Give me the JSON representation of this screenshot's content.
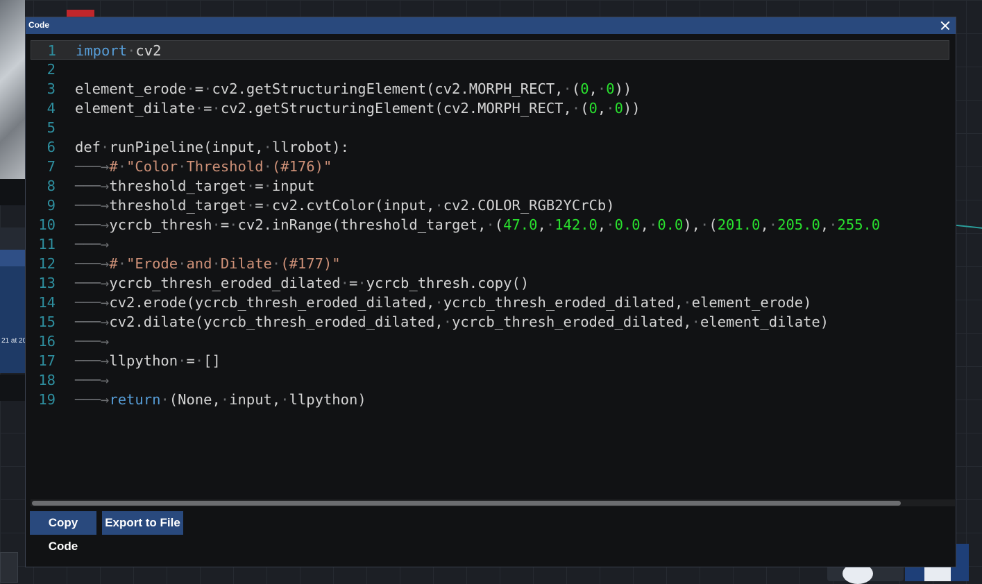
{
  "window": {
    "title": "Code"
  },
  "background": {
    "date_snippet": "21 at 20"
  },
  "editor": {
    "lines": [
      {
        "num": "1",
        "tokens": [
          {
            "t": "import",
            "c": "kw"
          },
          {
            "t": "·",
            "c": "ws"
          },
          {
            "t": "cv2",
            "c": ""
          }
        ]
      },
      {
        "num": "2",
        "tokens": []
      },
      {
        "num": "3",
        "tokens": [
          {
            "t": "element_erode",
            "c": ""
          },
          {
            "t": "·",
            "c": "ws"
          },
          {
            "t": "=",
            "c": ""
          },
          {
            "t": "·",
            "c": "ws"
          },
          {
            "t": "cv2.getStructuringElement(cv2.MORPH_RECT,",
            "c": ""
          },
          {
            "t": "·",
            "c": "ws"
          },
          {
            "t": "(",
            "c": ""
          },
          {
            "t": "0",
            "c": "num"
          },
          {
            "t": ",",
            "c": ""
          },
          {
            "t": "·",
            "c": "ws"
          },
          {
            "t": "0",
            "c": "num"
          },
          {
            "t": "))",
            "c": ""
          }
        ]
      },
      {
        "num": "4",
        "tokens": [
          {
            "t": "element_dilate",
            "c": ""
          },
          {
            "t": "·",
            "c": "ws"
          },
          {
            "t": "=",
            "c": ""
          },
          {
            "t": "·",
            "c": "ws"
          },
          {
            "t": "cv2.getStructuringElement(cv2.MORPH_RECT,",
            "c": ""
          },
          {
            "t": "·",
            "c": "ws"
          },
          {
            "t": "(",
            "c": ""
          },
          {
            "t": "0",
            "c": "num"
          },
          {
            "t": ",",
            "c": ""
          },
          {
            "t": "·",
            "c": "ws"
          },
          {
            "t": "0",
            "c": "num"
          },
          {
            "t": "))",
            "c": ""
          }
        ]
      },
      {
        "num": "5",
        "tokens": []
      },
      {
        "num": "6",
        "tokens": [
          {
            "t": "def",
            "c": ""
          },
          {
            "t": "·",
            "c": "ws"
          },
          {
            "t": "runPipeline(input,",
            "c": ""
          },
          {
            "t": "·",
            "c": "ws"
          },
          {
            "t": "llrobot):",
            "c": ""
          }
        ]
      },
      {
        "num": "7",
        "tokens": [
          {
            "t": "───→",
            "c": "ws"
          },
          {
            "t": "#",
            "c": "str"
          },
          {
            "t": "·",
            "c": "ws"
          },
          {
            "t": "\"Color",
            "c": "str"
          },
          {
            "t": "·",
            "c": "ws"
          },
          {
            "t": "Threshold",
            "c": "str"
          },
          {
            "t": "·",
            "c": "ws"
          },
          {
            "t": "(#176)\"",
            "c": "str"
          }
        ]
      },
      {
        "num": "8",
        "tokens": [
          {
            "t": "───→",
            "c": "ws"
          },
          {
            "t": "threshold_target",
            "c": ""
          },
          {
            "t": "·",
            "c": "ws"
          },
          {
            "t": "=",
            "c": ""
          },
          {
            "t": "·",
            "c": "ws"
          },
          {
            "t": "input",
            "c": ""
          }
        ]
      },
      {
        "num": "9",
        "tokens": [
          {
            "t": "───→",
            "c": "ws"
          },
          {
            "t": "threshold_target",
            "c": ""
          },
          {
            "t": "·",
            "c": "ws"
          },
          {
            "t": "=",
            "c": ""
          },
          {
            "t": "·",
            "c": "ws"
          },
          {
            "t": "cv2.cvtColor(input,",
            "c": ""
          },
          {
            "t": "·",
            "c": "ws"
          },
          {
            "t": "cv2.COLOR_RGB2YCrCb)",
            "c": ""
          }
        ]
      },
      {
        "num": "10",
        "tokens": [
          {
            "t": "───→",
            "c": "ws"
          },
          {
            "t": "ycrcb_thresh",
            "c": ""
          },
          {
            "t": "·",
            "c": "ws"
          },
          {
            "t": "=",
            "c": ""
          },
          {
            "t": "·",
            "c": "ws"
          },
          {
            "t": "cv2.inRange(threshold_target,",
            "c": ""
          },
          {
            "t": "·",
            "c": "ws"
          },
          {
            "t": "(",
            "c": ""
          },
          {
            "t": "47.0",
            "c": "num"
          },
          {
            "t": ",",
            "c": ""
          },
          {
            "t": "·",
            "c": "ws"
          },
          {
            "t": "142.0",
            "c": "num"
          },
          {
            "t": ",",
            "c": ""
          },
          {
            "t": "·",
            "c": "ws"
          },
          {
            "t": "0.0",
            "c": "num"
          },
          {
            "t": ",",
            "c": ""
          },
          {
            "t": "·",
            "c": "ws"
          },
          {
            "t": "0.0",
            "c": "num"
          },
          {
            "t": "),",
            "c": ""
          },
          {
            "t": "·",
            "c": "ws"
          },
          {
            "t": "(",
            "c": ""
          },
          {
            "t": "201.0",
            "c": "num"
          },
          {
            "t": ",",
            "c": ""
          },
          {
            "t": "·",
            "c": "ws"
          },
          {
            "t": "205.0",
            "c": "num"
          },
          {
            "t": ",",
            "c": ""
          },
          {
            "t": "·",
            "c": "ws"
          },
          {
            "t": "255.0",
            "c": "num"
          }
        ]
      },
      {
        "num": "11",
        "tokens": [
          {
            "t": "───→",
            "c": "ws"
          }
        ]
      },
      {
        "num": "12",
        "tokens": [
          {
            "t": "───→",
            "c": "ws"
          },
          {
            "t": "#",
            "c": "str"
          },
          {
            "t": "·",
            "c": "ws"
          },
          {
            "t": "\"Erode",
            "c": "str"
          },
          {
            "t": "·",
            "c": "ws"
          },
          {
            "t": "and",
            "c": "str"
          },
          {
            "t": "·",
            "c": "ws"
          },
          {
            "t": "Dilate",
            "c": "str"
          },
          {
            "t": "·",
            "c": "ws"
          },
          {
            "t": "(#177)\"",
            "c": "str"
          }
        ]
      },
      {
        "num": "13",
        "tokens": [
          {
            "t": "───→",
            "c": "ws"
          },
          {
            "t": "ycrcb_thresh_eroded_dilated",
            "c": ""
          },
          {
            "t": "·",
            "c": "ws"
          },
          {
            "t": "=",
            "c": ""
          },
          {
            "t": "·",
            "c": "ws"
          },
          {
            "t": "ycrcb_thresh.copy()",
            "c": ""
          }
        ]
      },
      {
        "num": "14",
        "tokens": [
          {
            "t": "───→",
            "c": "ws"
          },
          {
            "t": "cv2.erode(ycrcb_thresh_eroded_dilated,",
            "c": ""
          },
          {
            "t": "·",
            "c": "ws"
          },
          {
            "t": "ycrcb_thresh_eroded_dilated,",
            "c": ""
          },
          {
            "t": "·",
            "c": "ws"
          },
          {
            "t": "element_erode)",
            "c": ""
          }
        ]
      },
      {
        "num": "15",
        "tokens": [
          {
            "t": "───→",
            "c": "ws"
          },
          {
            "t": "cv2.dilate(ycrcb_thresh_eroded_dilated,",
            "c": ""
          },
          {
            "t": "·",
            "c": "ws"
          },
          {
            "t": "ycrcb_thresh_eroded_dilated,",
            "c": ""
          },
          {
            "t": "·",
            "c": "ws"
          },
          {
            "t": "element_dilate)",
            "c": ""
          }
        ]
      },
      {
        "num": "16",
        "tokens": [
          {
            "t": "───→",
            "c": "ws"
          }
        ]
      },
      {
        "num": "17",
        "tokens": [
          {
            "t": "───→",
            "c": "ws"
          },
          {
            "t": "llpython",
            "c": ""
          },
          {
            "t": "·",
            "c": "ws"
          },
          {
            "t": "=",
            "c": ""
          },
          {
            "t": "·",
            "c": "ws"
          },
          {
            "t": "[]",
            "c": ""
          }
        ]
      },
      {
        "num": "18",
        "tokens": [
          {
            "t": "───→",
            "c": "ws"
          }
        ]
      },
      {
        "num": "19",
        "tokens": [
          {
            "t": "───→",
            "c": "ws"
          },
          {
            "t": "return",
            "c": "kw"
          },
          {
            "t": "·",
            "c": "ws"
          },
          {
            "t": "(None,",
            "c": ""
          },
          {
            "t": "·",
            "c": "ws"
          },
          {
            "t": "input,",
            "c": ""
          },
          {
            "t": "·",
            "c": "ws"
          },
          {
            "t": "llpython)",
            "c": ""
          }
        ]
      }
    ]
  },
  "buttons": {
    "copy": "Copy Code",
    "export": "Export to File"
  },
  "colors": {
    "keyword": "#569cd6",
    "number": "#29e12e",
    "string": "#ce9178",
    "line_number": "#2e8f9f",
    "accent": "#29497d"
  }
}
